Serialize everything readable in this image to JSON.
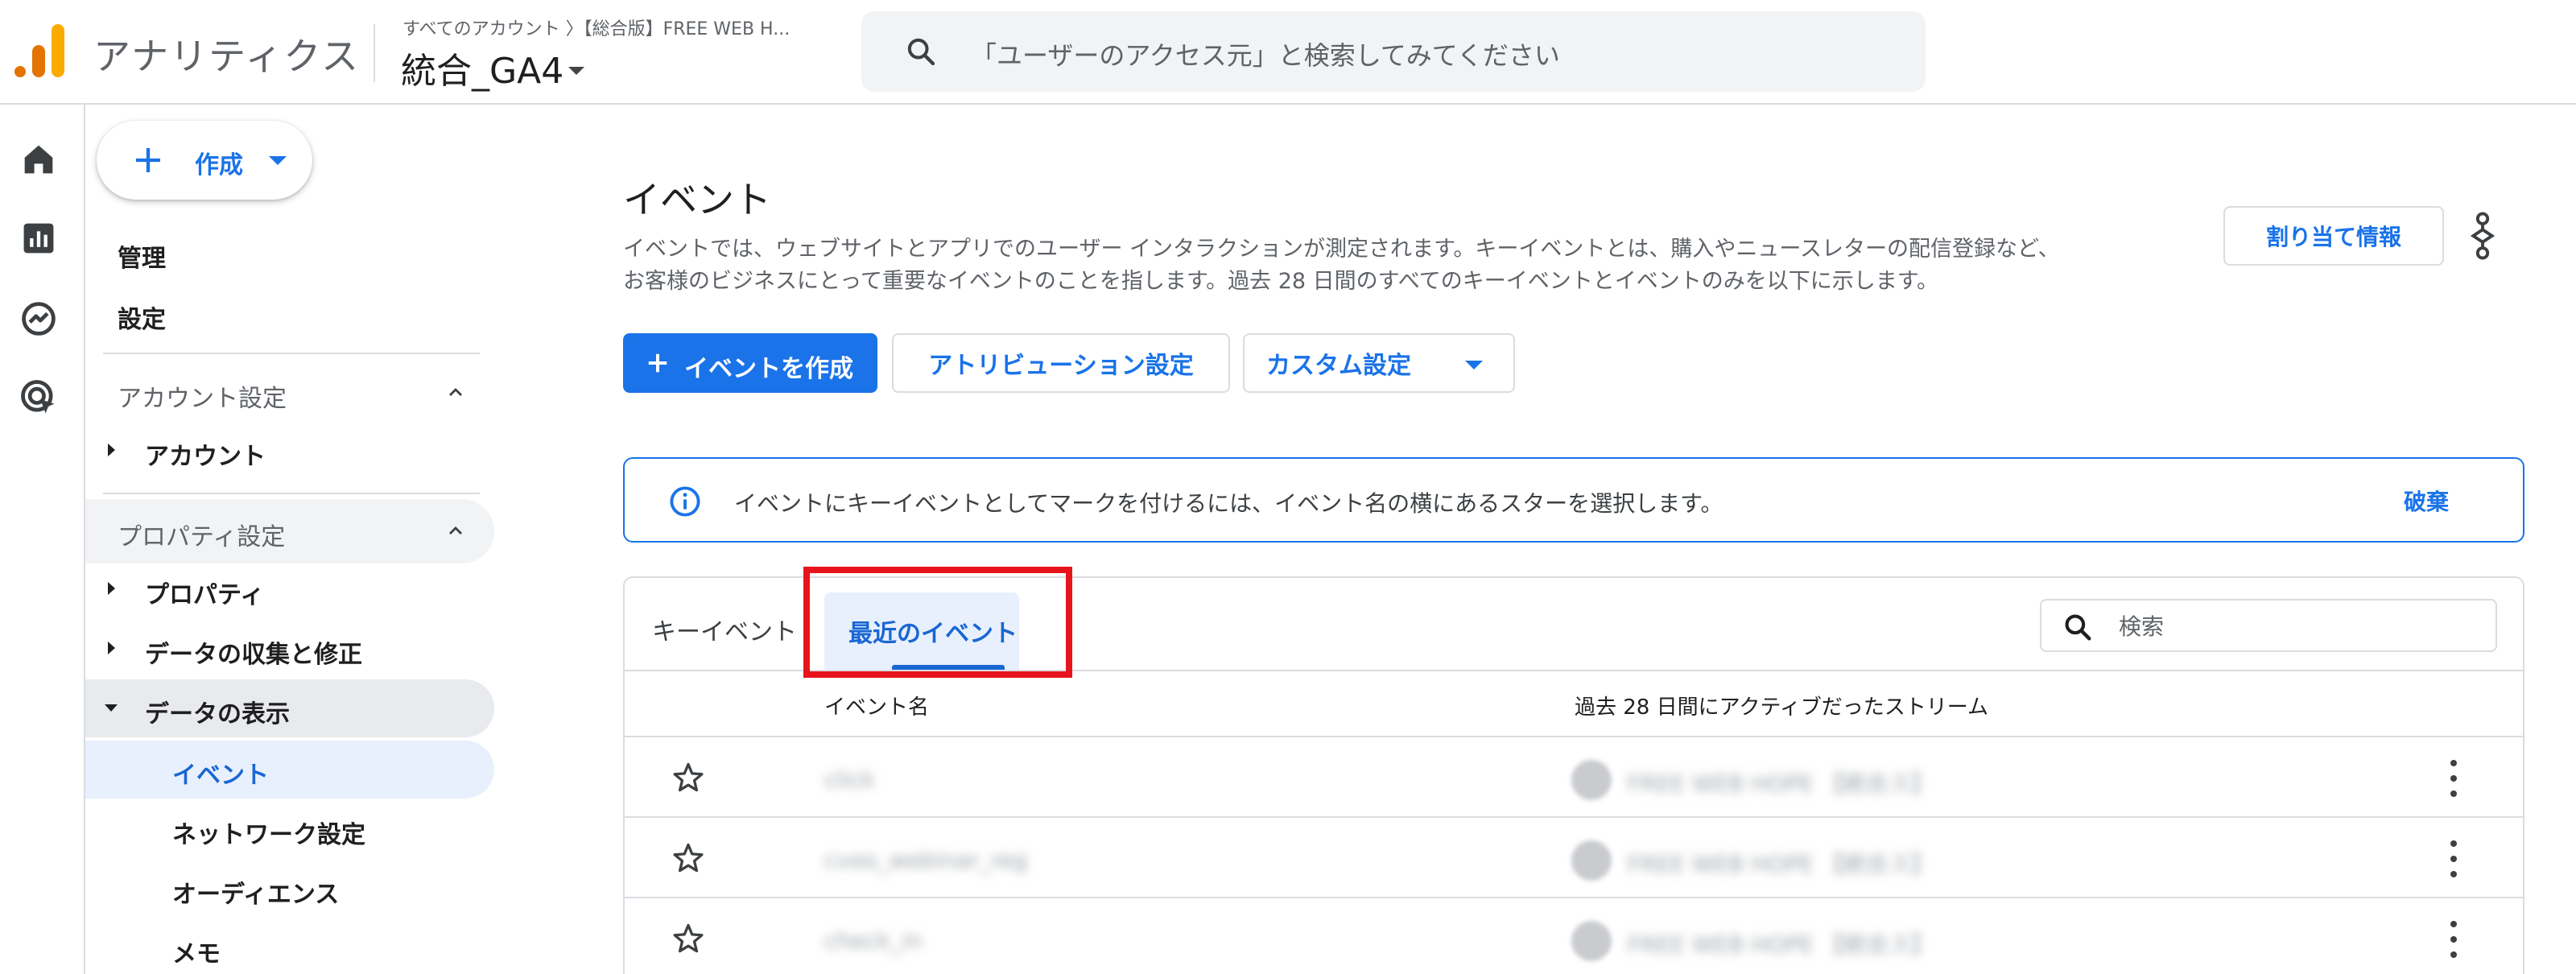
{
  "topbar": {
    "app_title": "アナリティクス",
    "account_path": "すべてのアカウント 〉【総合版】FREE WEB H...",
    "property_name": "統合_GA4",
    "search_placeholder": "「ユーザーのアクセス元」と検索してみてください"
  },
  "rail": {
    "items": [
      "home-icon",
      "reports-icon",
      "explore-icon",
      "advertising-icon"
    ]
  },
  "sidenav": {
    "create_label": "作成",
    "admin": "管理",
    "settings": "設定",
    "account_settings": "アカウント設定",
    "account": "アカウント",
    "property_settings": "プロパティ設定",
    "property": "プロパティ",
    "data_collection": "データの収集と修正",
    "data_display": "データの表示",
    "sub_items": [
      "イベント",
      "ネットワーク設定",
      "オーディエンス",
      "メモ"
    ]
  },
  "main": {
    "title": "イベント",
    "description_line1": "イベントでは、ウェブサイトとアプリでのユーザー インタラクションが測定されます。キーイベントとは、購入やニュースレターの配信登録など、",
    "description_line2": "お客様のビジネスにとって重要なイベントのことを指します。過去 28 日間のすべてのキーイベントとイベントのみを以下に示します。",
    "assign_button": "割り当て情報",
    "create_event_button": "イベントを作成",
    "attribution_button": "アトリビューション設定",
    "custom_button": "カスタム設定",
    "banner_message": "イベントにキーイベントとしてマークを付けるには、イベント名の横にあるスターを選択します。",
    "banner_dismiss": "破棄"
  },
  "table": {
    "tabs": [
      "キーイベント",
      "最近のイベント"
    ],
    "active_tab": "最近のイベント",
    "search_placeholder": "検索",
    "columns": [
      "イベント名",
      "過去 28 日間にアクティブだったストリーム"
    ],
    "rows": [
      {
        "event_name": "click",
        "stream": "FREE WEB HOPE 【統合ス】"
      },
      {
        "event_name": "cvoo_webinar_reg",
        "stream": "FREE WEB HOPE 【統合ス】"
      },
      {
        "event_name": "check_in",
        "stream": "FREE WEB HOPE 【統合ス】"
      }
    ]
  },
  "colors": {
    "accent": "#1a73e8",
    "active_bg": "#e8f0fe",
    "highlight": "#e8141c",
    "border": "#dadce0"
  }
}
